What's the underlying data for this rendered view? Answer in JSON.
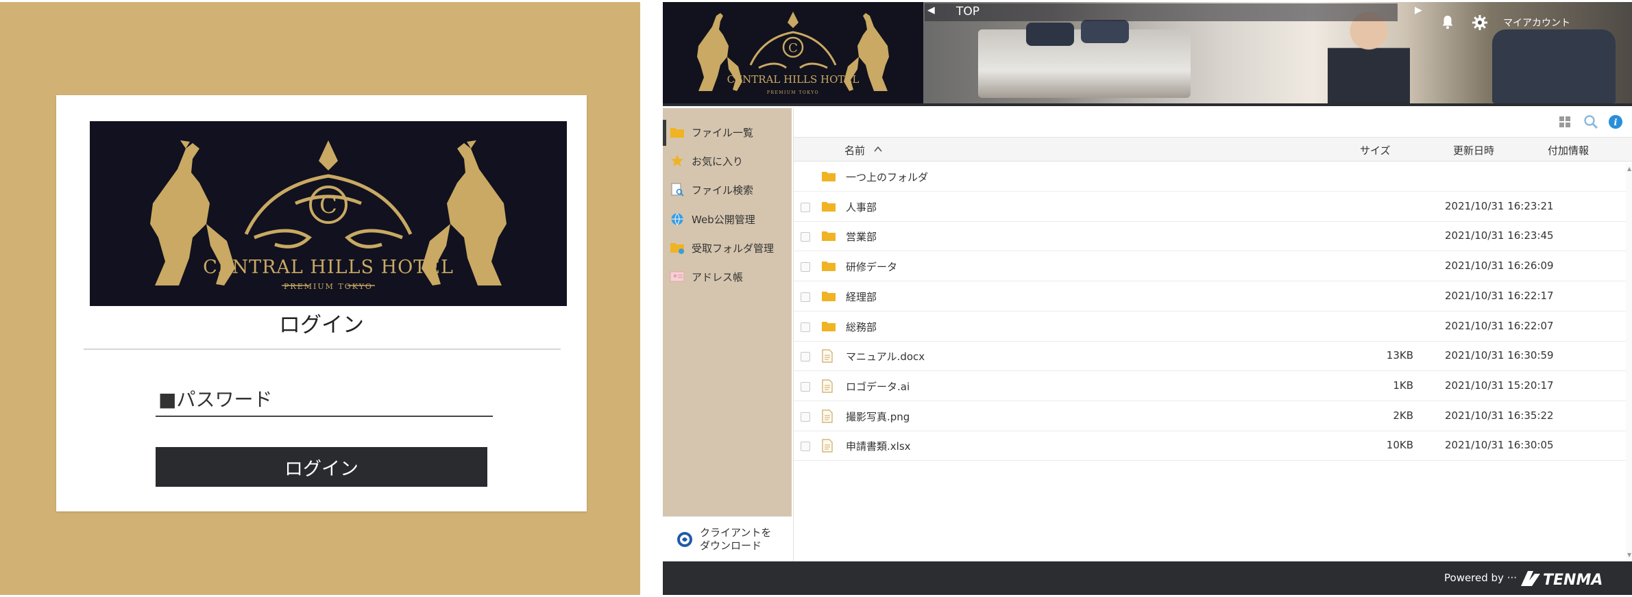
{
  "login": {
    "logo_text": "CENTRAL HILLS HOTEL",
    "logo_sub": "PREMIUM TOKYO",
    "logo_letter": "C",
    "title": "ログイン",
    "password_placeholder": "■パスワード",
    "button_label": "ログイン"
  },
  "banner": {
    "logo_text": "CENTRAL HILLS HOTEL",
    "logo_sub": "PREMIUM TOKYO",
    "logo_letter": "C",
    "top_label": "TOP",
    "account_label": "マイアカウント"
  },
  "sidebar": {
    "items": [
      {
        "label": "ファイル一覧",
        "icon": "folder-icon"
      },
      {
        "label": "お気に入り",
        "icon": "star-icon"
      },
      {
        "label": "ファイル検索",
        "icon": "file-search-icon"
      },
      {
        "label": "Web公開管理",
        "icon": "globe-icon"
      },
      {
        "label": "受取フォルダ管理",
        "icon": "inbox-folder-icon"
      },
      {
        "label": "アドレス帳",
        "icon": "address-book-icon"
      }
    ],
    "download_label_1": "クライアントを",
    "download_label_2": "ダウンロード"
  },
  "table": {
    "headers": {
      "name": "名前",
      "size": "サイズ",
      "date": "更新日時",
      "info": "付加情報"
    },
    "parent_folder": "一つ上のフォルダ",
    "rows": [
      {
        "name": "人事部",
        "type": "folder",
        "size": "",
        "date": "2021/10/31 16:23:21"
      },
      {
        "name": "営業部",
        "type": "folder",
        "size": "",
        "date": "2021/10/31 16:23:45"
      },
      {
        "name": "研修データ",
        "type": "folder",
        "size": "",
        "date": "2021/10/31 16:26:09"
      },
      {
        "name": "経理部",
        "type": "folder",
        "size": "",
        "date": "2021/10/31 16:22:17"
      },
      {
        "name": "総務部",
        "type": "folder",
        "size": "",
        "date": "2021/10/31 16:22:07"
      },
      {
        "name": "マニュアル.docx",
        "type": "file",
        "size": "13KB",
        "date": "2021/10/31 16:30:59"
      },
      {
        "name": "ロゴデータ.ai",
        "type": "file",
        "size": "1KB",
        "date": "2021/10/31 15:20:17"
      },
      {
        "name": "撮影写真.png",
        "type": "file",
        "size": "2KB",
        "date": "2021/10/31 16:35:22"
      },
      {
        "name": "申請書類.xlsx",
        "type": "file",
        "size": "10KB",
        "date": "2021/10/31 16:30:05"
      }
    ]
  },
  "footer": {
    "powered_label": "Powered by ···",
    "brand": "TENMA"
  },
  "colors": {
    "login_bg": "#d2b274",
    "gold": "#c9a963",
    "navy": "#11111f",
    "sidebar_bg": "#d5c5ae",
    "footer_bg": "#2c2d31",
    "folder": "#f0b323",
    "info": "#2a8fd8"
  }
}
